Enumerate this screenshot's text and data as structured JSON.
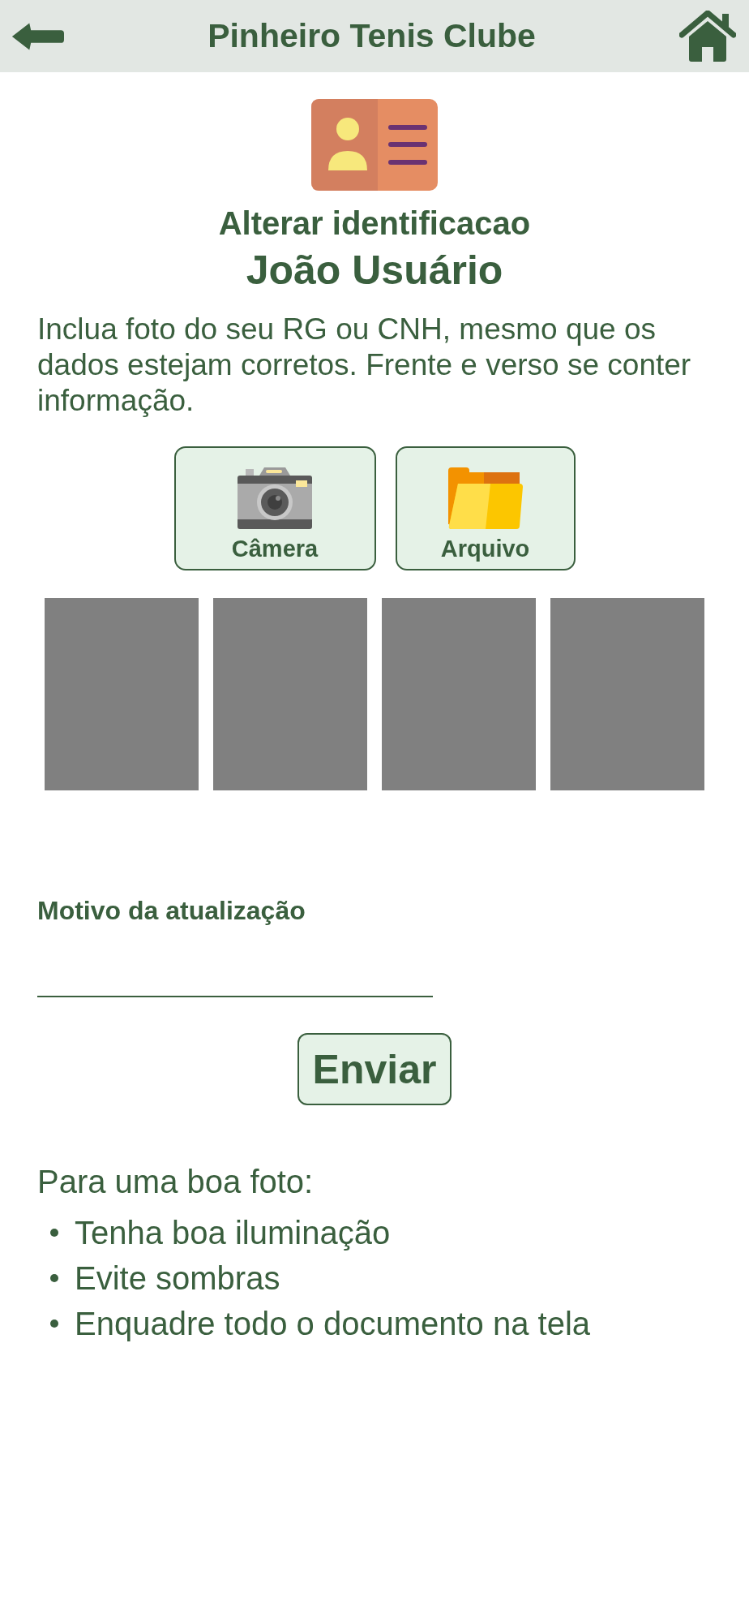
{
  "header": {
    "title": "Pinheiro Tenis Clube"
  },
  "heading": "Alterar identificacao",
  "user_name": "João Usuário",
  "instructions": "Inclua foto do seu RG ou CNH, mesmo que os dados estejam corretos. Frente e verso se conter informação.",
  "source_buttons": [
    {
      "kind": "camera",
      "label": "Câmera"
    },
    {
      "kind": "file",
      "label": "Arquivo"
    }
  ],
  "photo_slots": [
    {
      "kind": "empty"
    },
    {
      "kind": "empty"
    },
    {
      "kind": "empty"
    },
    {
      "kind": "empty"
    }
  ],
  "reason_field": {
    "label": "Motivo da atualização"
  },
  "submit_button": "Enviar",
  "tips": {
    "title": "Para uma boa foto:",
    "items": [
      "Tenha boa iluminação",
      "Evite sombras",
      "Enquadre todo o documento na tela"
    ]
  }
}
